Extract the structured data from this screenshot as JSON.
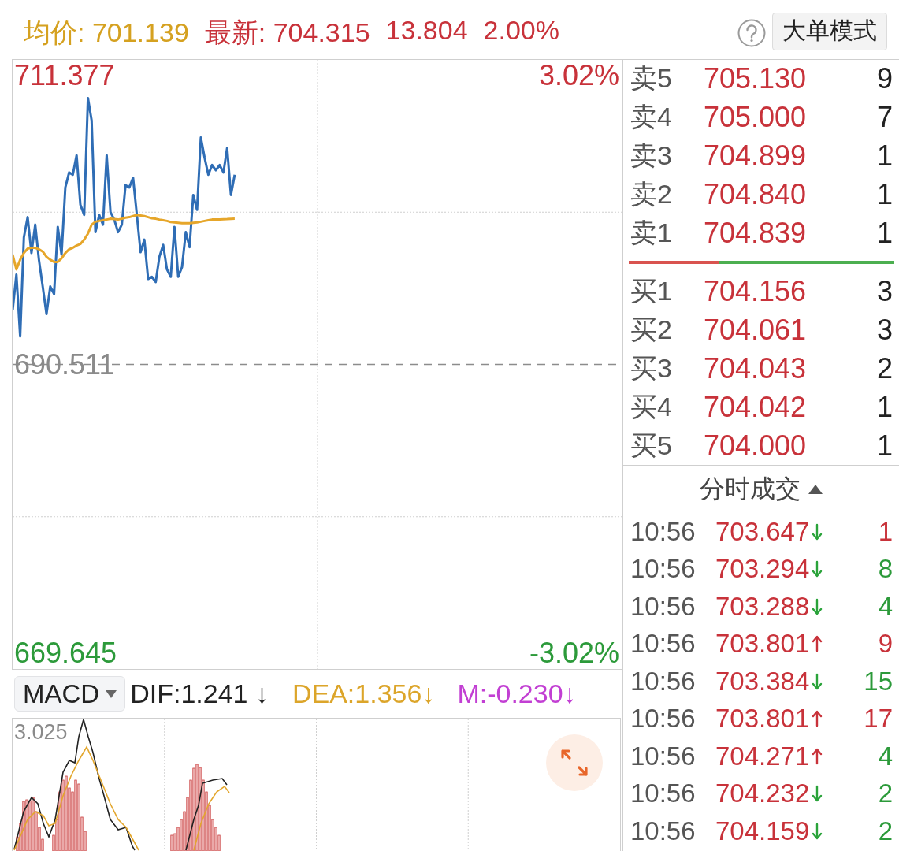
{
  "header": {
    "avg": "均价: 701.139",
    "latest": "最新: 704.315",
    "change": "13.804",
    "change_pct": "2.00%",
    "mode_button": "大单模式"
  },
  "price_chart": {
    "pct_high": "3.02%",
    "pct_low": "-3.02%",
    "chart_data": {
      "type": "line",
      "categories": [
        null,
        null,
        null,
        null,
        null,
        null,
        null,
        null,
        null,
        null,
        null,
        null,
        null,
        null,
        null,
        null,
        null,
        null,
        null,
        null,
        null,
        null,
        null,
        null,
        null,
        null,
        null,
        null,
        null,
        null,
        null,
        null,
        null,
        null,
        null,
        null,
        null,
        null,
        null,
        null,
        null,
        null,
        null,
        null,
        null,
        null,
        null,
        null,
        null,
        null,
        null,
        null,
        null,
        null,
        null,
        null,
        null,
        null,
        null,
        null,
        null,
        null,
        null,
        null,
        null,
        null,
        null,
        null,
        null,
        null,
        null,
        null,
        null,
        null,
        null,
        null,
        null,
        null,
        null,
        null,
        null,
        null,
        null,
        null,
        null,
        null,
        null,
        null,
        null,
        null,
        null,
        null,
        null,
        null,
        null,
        null,
        null,
        null,
        null,
        null,
        null,
        null,
        null,
        null,
        null,
        null,
        null,
        null,
        null,
        null,
        null,
        null,
        null,
        null,
        null,
        null,
        null,
        null,
        null,
        null,
        null,
        null,
        null,
        null,
        null,
        null,
        null,
        null,
        null,
        null,
        null,
        null,
        null,
        null,
        null,
        null,
        null,
        null,
        null,
        null,
        null,
        null,
        null,
        null,
        null,
        null,
        null,
        null,
        null,
        null,
        null,
        null,
        null,
        null,
        null,
        null,
        null,
        null,
        null,
        null,
        null,
        null,
        null
      ],
      "ylim": [
        668.506,
        712.516
      ],
      "yticks": [
        {
          "value": 669.645,
          "label": "669.645"
        },
        {
          "value": 690.511,
          "label": "690.511"
        },
        {
          "value": 711.377,
          "label": "711.377"
        }
      ],
      "ref_lines": [
        {
          "axis": "y",
          "value": 690.511
        }
      ],
      "series": [
        {
          "color": "#2f6db5",
          "values": [
            694.42,
            697.0,
            692.53,
            699.69,
            701.15,
            698.56,
            700.61,
            698.08,
            696.14,
            694.15,
            696.14,
            695.6,
            700.45,
            698.45,
            703.3,
            704.38,
            704.22,
            705.62,
            702.06,
            701.31,
            709.76,
            708.15,
            700.07,
            701.31,
            700.61,
            705.62,
            701.52,
            700.98,
            700.07,
            700.61,
            703.46,
            703.3,
            704.0,
            701.31,
            698.62,
            699.53,
            696.68,
            696.84,
            696.46,
            698.29,
            699.15,
            697.38,
            696.84,
            700.45,
            696.84,
            697.54,
            700.07,
            698.99,
            702.76,
            701.68,
            706.91,
            705.45,
            704.22,
            704.92,
            704.54,
            704.92,
            704.38,
            706.15,
            702.76,
            704.22,
            null,
            null,
            null,
            null,
            null,
            null,
            null,
            null,
            null,
            null,
            null,
            null,
            null,
            null,
            null,
            null,
            null,
            null,
            null,
            null,
            null,
            null,
            null,
            null,
            null,
            null,
            null,
            null,
            null,
            null,
            null,
            null,
            null,
            null,
            null,
            null,
            null,
            null,
            null,
            null,
            null,
            null,
            null,
            null,
            null,
            null,
            null,
            null,
            null,
            null,
            null,
            null,
            null,
            null,
            null,
            null,
            null,
            null,
            null,
            null,
            null,
            null,
            null,
            null,
            null,
            null,
            null,
            null,
            null,
            null,
            null,
            null,
            null,
            null,
            null,
            null,
            null,
            null,
            null,
            null,
            null,
            null,
            null,
            null,
            null,
            null,
            null,
            null,
            null,
            null,
            null,
            null,
            null,
            null,
            null,
            null,
            null,
            null,
            null,
            null,
            null,
            null,
            null
          ]
        },
        {
          "color": "#e6a62a",
          "values": [
            698.45,
            697.38,
            698.08,
            698.56,
            698.88,
            698.94,
            698.94,
            698.83,
            698.67,
            698.29,
            698.08,
            697.92,
            697.92,
            698.18,
            698.56,
            698.83,
            698.94,
            699.1,
            699.21,
            699.53,
            699.96,
            700.61,
            700.82,
            700.88,
            700.93,
            700.98,
            701.04,
            701.01,
            700.98,
            701.04,
            701.12,
            701.15,
            701.23,
            701.31,
            701.28,
            701.23,
            701.15,
            701.07,
            701.04,
            700.98,
            700.93,
            700.88,
            700.8,
            700.77,
            700.74,
            700.72,
            700.72,
            700.72,
            700.75,
            700.77,
            700.82,
            700.88,
            700.93,
            700.98,
            700.98,
            700.99,
            701.0,
            701.01,
            701.03,
            701.04,
            null,
            null,
            null,
            null,
            null,
            null,
            null,
            null,
            null,
            null,
            null,
            null,
            null,
            null,
            null,
            null,
            null,
            null,
            null,
            null,
            null,
            null,
            null,
            null,
            null,
            null,
            null,
            null,
            null,
            null,
            null,
            null,
            null,
            null,
            null,
            null,
            null,
            null,
            null,
            null,
            null,
            null,
            null,
            null,
            null,
            null,
            null,
            null,
            null,
            null,
            null,
            null,
            null,
            null,
            null,
            null,
            null,
            null,
            null,
            null,
            null,
            null,
            null,
            null,
            null,
            null,
            null,
            null,
            null,
            null,
            null,
            null,
            null,
            null,
            null,
            null,
            null,
            null,
            null,
            null,
            null,
            null,
            null,
            null,
            null,
            null,
            null,
            null,
            null,
            null,
            null,
            null,
            null,
            null,
            null,
            null,
            null,
            null,
            null,
            null,
            null,
            null,
            null
          ]
        }
      ]
    }
  },
  "indicator": {
    "selector": "MACD",
    "dif": "DIF:1.241 ↓",
    "dea": "DEA:1.356↓",
    "m": "M:-0.230↓"
  },
  "macd_chart": {
    "top_label": "3.025"
  },
  "order_book": {
    "asks": [
      {
        "label": "卖5",
        "price": "705.130",
        "volume": "9"
      },
      {
        "label": "卖4",
        "price": "705.000",
        "volume": "7"
      },
      {
        "label": "卖3",
        "price": "704.899",
        "volume": "1"
      },
      {
        "label": "卖2",
        "price": "704.840",
        "volume": "1"
      },
      {
        "label": "卖1",
        "price": "704.839",
        "volume": "1"
      }
    ],
    "ratio_bar": {
      "level": 0.34
    },
    "bids": [
      {
        "label": "买1",
        "price": "704.156",
        "volume": "3"
      },
      {
        "label": "买2",
        "price": "704.061",
        "volume": "3"
      },
      {
        "label": "买3",
        "price": "704.043",
        "volume": "2"
      },
      {
        "label": "买4",
        "price": "704.042",
        "volume": "1"
      },
      {
        "label": "买5",
        "price": "704.000",
        "volume": "1"
      }
    ]
  },
  "trades": {
    "title": "分时成交",
    "rows": [
      {
        "time": "10:56",
        "price": "703.647",
        "rising": false,
        "color": "#c8323a",
        "volume": "1"
      },
      {
        "time": "10:56",
        "price": "703.294",
        "rising": false,
        "color": "#2c9a3a",
        "volume": "8"
      },
      {
        "time": "10:56",
        "price": "703.288",
        "rising": false,
        "color": "#2c9a3a",
        "volume": "4"
      },
      {
        "time": "10:56",
        "price": "703.801",
        "rising": true,
        "color": "#c8323a",
        "volume": "9"
      },
      {
        "time": "10:56",
        "price": "703.384",
        "rising": false,
        "color": "#2c9a3a",
        "volume": "15"
      },
      {
        "time": "10:56",
        "price": "703.801",
        "rising": true,
        "color": "#c8323a",
        "volume": "17"
      },
      {
        "time": "10:56",
        "price": "704.271",
        "rising": true,
        "color": "#2c9a3a",
        "volume": "4"
      },
      {
        "time": "10:56",
        "price": "704.232",
        "rising": false,
        "color": "#2c9a3a",
        "volume": "2"
      },
      {
        "time": "10:56",
        "price": "704.159",
        "rising": false,
        "color": "#2c9a3a",
        "volume": "2"
      }
    ]
  }
}
